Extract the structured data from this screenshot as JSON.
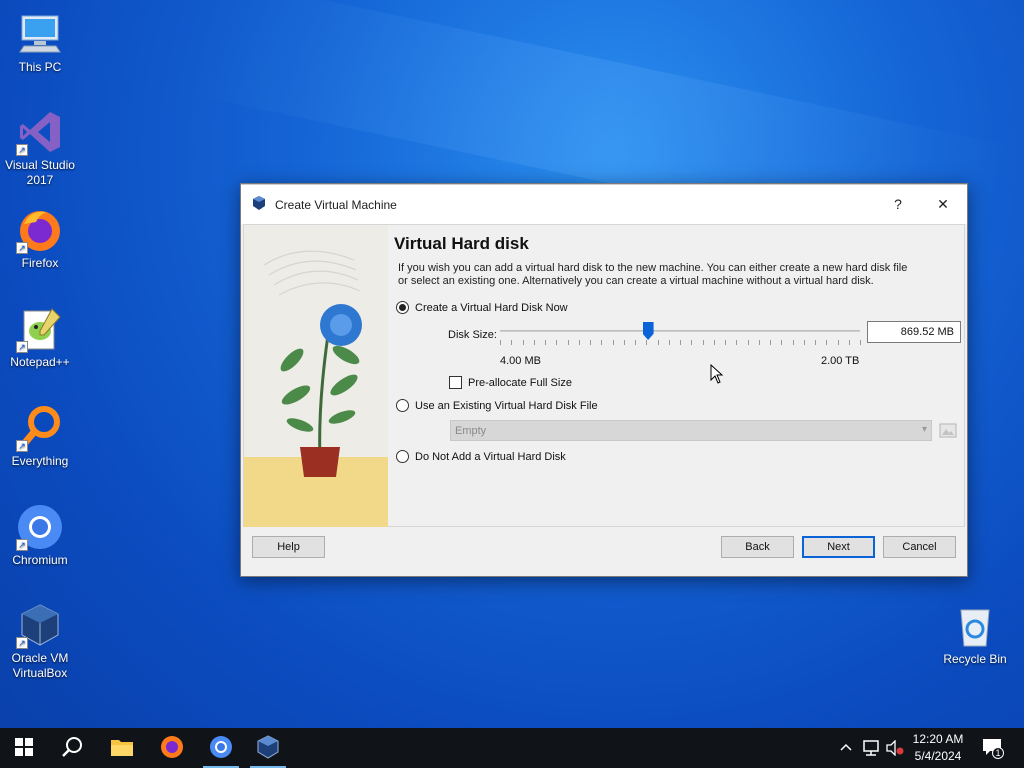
{
  "desktop": {
    "icons": [
      {
        "label": "This PC",
        "icon": "computer-icon"
      },
      {
        "label": "Visual Studio 2017",
        "icon": "visual-studio-icon"
      },
      {
        "label": "Firefox",
        "icon": "firefox-icon"
      },
      {
        "label": "Notepad++",
        "icon": "notepadpp-icon"
      },
      {
        "label": "Everything",
        "icon": "everything-icon"
      },
      {
        "label": "Chromium",
        "icon": "chromium-icon"
      },
      {
        "label": "Oracle VM VirtualBox",
        "icon": "virtualbox-icon"
      }
    ],
    "recycle_bin": {
      "label": "Recycle Bin",
      "icon": "recycle-bin-icon"
    }
  },
  "dialog": {
    "title": "Create Virtual Machine",
    "help_glyph": "?",
    "close_glyph": "✕",
    "heading": "Virtual Hard disk",
    "description": "If you wish you can add a virtual hard disk to the new machine. You can either create a new hard disk file or select an existing one. Alternatively you can create a virtual machine without a virtual hard disk.",
    "options": {
      "create_new": {
        "label": "Create a Virtual Hard Disk Now",
        "selected": true
      },
      "use_existing": {
        "label": "Use an Existing Virtual Hard Disk File",
        "selected": false
      },
      "no_disk": {
        "label": "Do Not Add a Virtual Hard Disk",
        "selected": false
      }
    },
    "disk_size": {
      "label": "Disk Size:",
      "value": "869.52 MB",
      "min_label": "4.00 MB",
      "max_label": "2.00 TB",
      "slider_fraction": 0.41
    },
    "preallocate": {
      "label": "Pre-allocate Full Size",
      "checked": false
    },
    "existing_file": {
      "value": "Empty"
    },
    "buttons": {
      "help": "Help",
      "back": "Back",
      "next": "Next",
      "cancel": "Cancel"
    }
  },
  "taskbar": {
    "apps": [
      "start-icon",
      "search-icon",
      "file-explorer-icon",
      "firefox-icon",
      "chromium-icon",
      "virtualbox-icon"
    ],
    "clock": {
      "time": "12:20 AM",
      "date": "5/4/2024"
    },
    "notifications_count": "1"
  },
  "colors": {
    "accent": "#0a64d8",
    "desktop": "#1565d6",
    "taskbar": "#101418"
  }
}
